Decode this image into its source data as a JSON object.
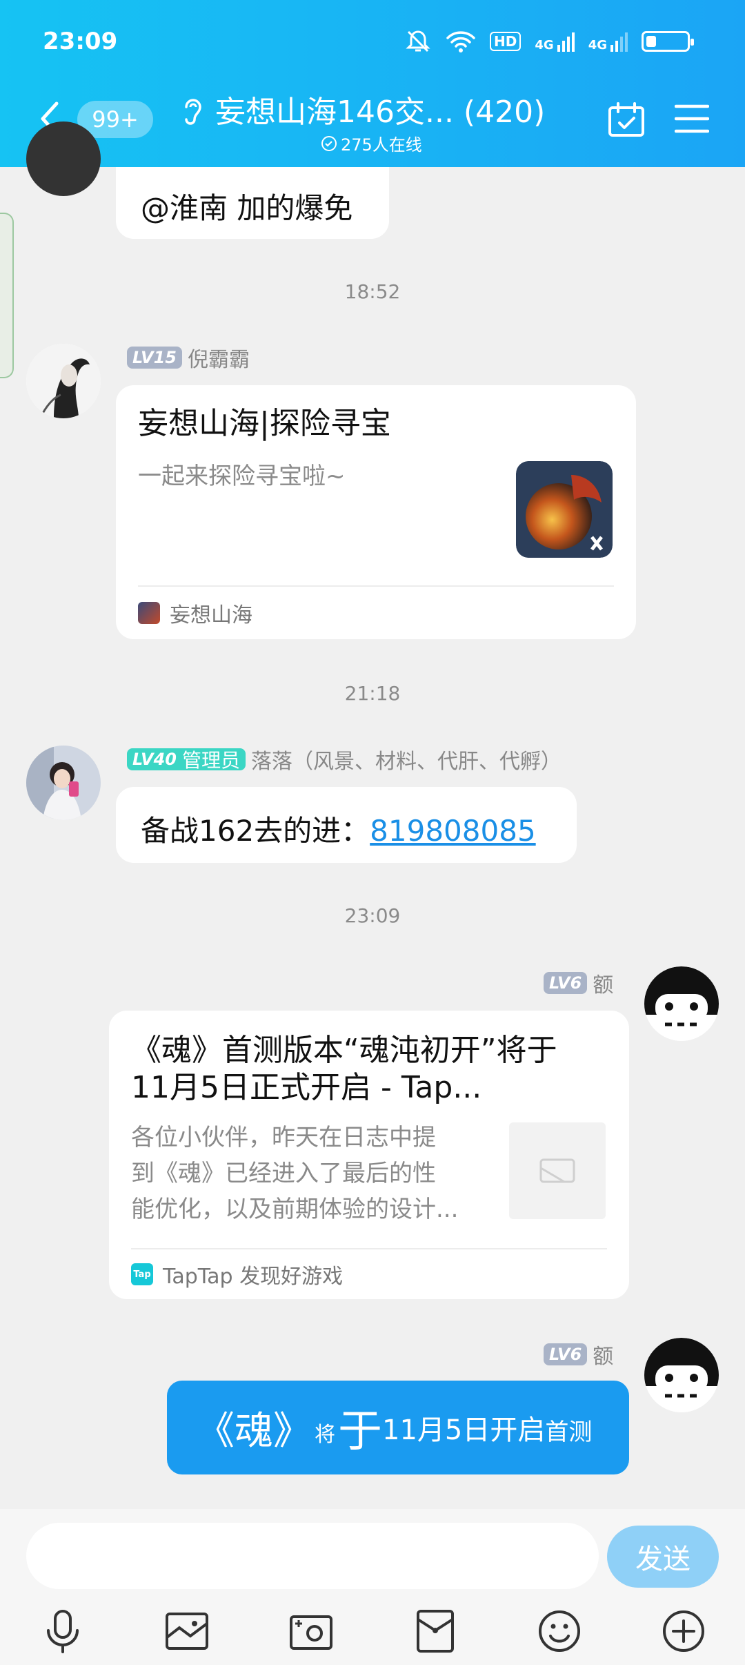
{
  "status_bar": {
    "time": "23:09",
    "hd_label": "HD",
    "net1": "4G",
    "net2": "4G",
    "battery_level": 0.25
  },
  "header": {
    "unread_count": "99+",
    "title": "妄想山海146交... (420)",
    "online": "275人在线"
  },
  "timestamps": [
    "18:52",
    "21:18",
    "23:09"
  ],
  "messages": {
    "m0": {
      "text": "@淮南 加的爆免"
    },
    "m1": {
      "level": "LV15",
      "sender": "倪霸霸",
      "card_title": "妄想山海|探险寻宝",
      "card_desc": "一起来探险寻宝啦~",
      "card_source": "妄想山海"
    },
    "m2": {
      "level": "LV40",
      "role": "管理员",
      "sender": "落落（风景、材料、代肝、代孵）",
      "text": "备战162去的进：",
      "link": "819808085"
    },
    "m3": {
      "level": "LV6",
      "sender": "额",
      "card_title_line1": "《魂》首测版本“魂沌初开”将于",
      "card_title_line2": "11月5日正式开启 - Tap...",
      "card_desc_line1": "各位小伙伴，昨天在日志中提",
      "card_desc_line2": "到《魂》已经进入了最后的性",
      "card_desc_line3": "能优化，以及前期体验的设计...",
      "card_source": "TapTap 发现好游戏",
      "source_icon_text": "Tap"
    },
    "m4": {
      "level": "LV6",
      "sender": "额",
      "parts": [
        "《魂》",
        "将",
        "于",
        "11月5日开启",
        "首测"
      ]
    }
  },
  "input": {
    "placeholder": "",
    "send_label": "发送"
  },
  "toolbar": [
    "mic-icon",
    "image-icon",
    "camera-icon",
    "red-packet-icon",
    "emoji-icon",
    "plus-icon"
  ],
  "colors": {
    "header_start": "#16c3f3",
    "header_end": "#1ba5f5",
    "self_bubble": "#1a9bf0",
    "link": "#1a8fe6",
    "admin_badge": "#3bd6c4"
  }
}
